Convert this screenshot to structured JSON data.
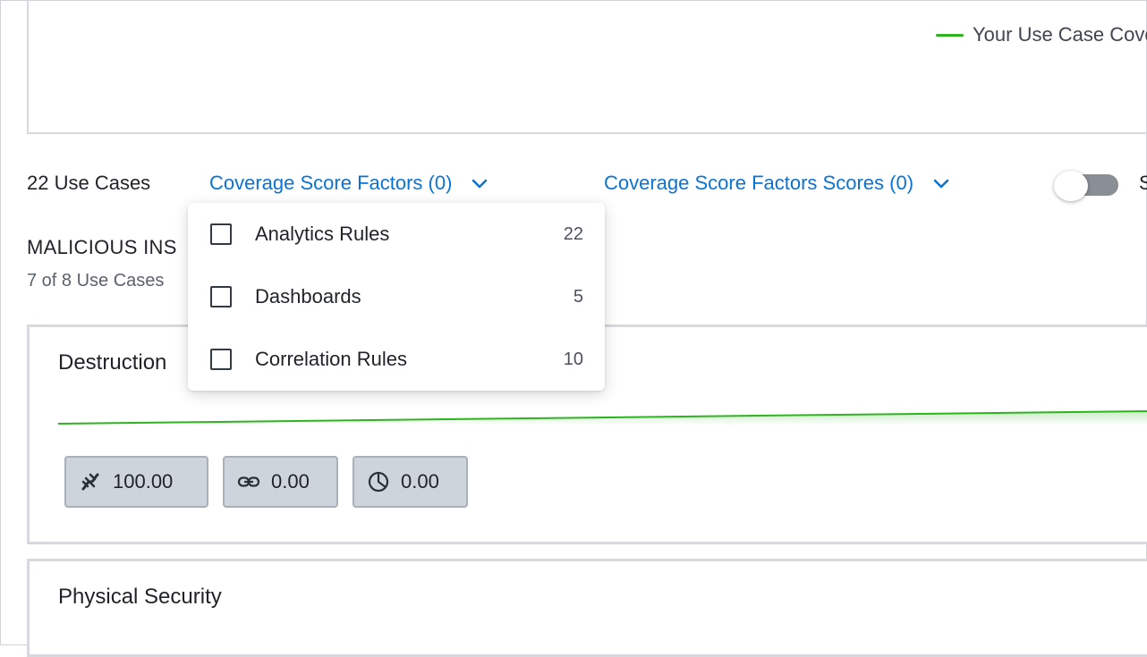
{
  "legend": {
    "label": "Your Use Case Cove",
    "color": "#2db41f"
  },
  "filters": {
    "use_case_count": "22 Use Cases",
    "factors_label": "Coverage Score Factors (0)",
    "factor_scores_label": "Coverage Score Factors Scores (0)",
    "toggle_on": false,
    "trailing_text": "S"
  },
  "menu": {
    "items": [
      {
        "label": "Analytics Rules",
        "count": "22",
        "checked": false
      },
      {
        "label": "Dashboards",
        "count": "5",
        "checked": false
      },
      {
        "label": "Correlation Rules",
        "count": "10",
        "checked": false
      }
    ]
  },
  "section": {
    "title": "MALICIOUS INS",
    "subtitle": "7 of 8 Use Cases"
  },
  "cards": [
    {
      "title": "Destruction",
      "metrics": [
        {
          "icon": "dna-icon",
          "value": "100.00"
        },
        {
          "icon": "link-icon",
          "value": "0.00"
        },
        {
          "icon": "pie-chart-icon",
          "value": "0.00"
        }
      ]
    },
    {
      "title": "Physical Security"
    }
  ],
  "colors": {
    "accent": "#0b73d1",
    "trend": "#2db41f"
  }
}
